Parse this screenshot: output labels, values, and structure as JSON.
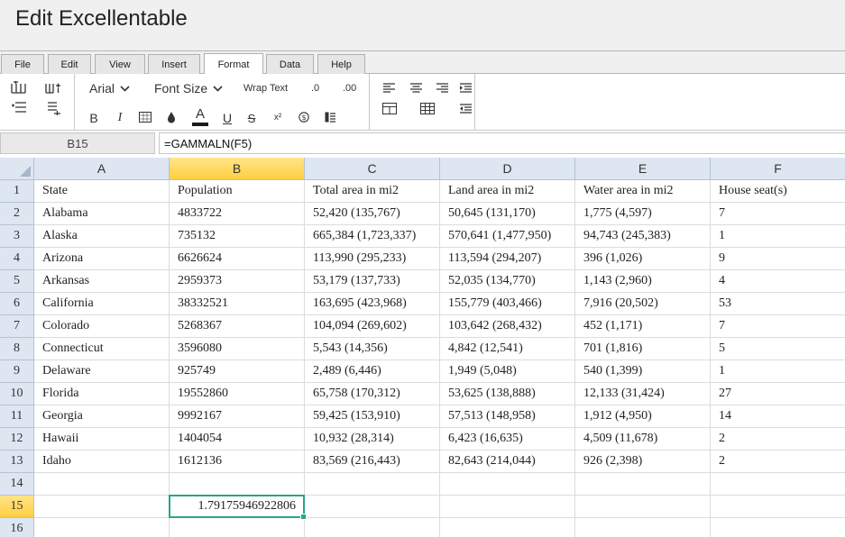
{
  "app": {
    "title": "Edit Excellentable"
  },
  "tabs": [
    "File",
    "Edit",
    "View",
    "Insert",
    "Format",
    "Data",
    "Help"
  ],
  "active_tab": "Format",
  "toolbar": {
    "font_name": "Arial",
    "font_size_label": "Font Size",
    "wrap_text": "Wrap Text",
    "decimal_decrease": ".0",
    "decimal_increase": ".00",
    "bold": "B",
    "italic": "I",
    "underline": "U",
    "strike": "S",
    "superscript": "x²",
    "text_color": "A",
    "text_color_hex": "#1a1a1a"
  },
  "formula_bar": {
    "cell_ref": "B15",
    "formula": "=GAMMALN(F5)"
  },
  "sheet": {
    "columns": [
      "A",
      "B",
      "C",
      "D",
      "E",
      "F"
    ],
    "rows": [
      [
        "State",
        "Population",
        "Total area in mi2",
        "Land area in mi2",
        "Water area in mi2",
        "House seat(s)"
      ],
      [
        "Alabama",
        "4833722",
        "52,420 (135,767)",
        "50,645 (131,170)",
        "1,775 (4,597)",
        "7"
      ],
      [
        "Alaska",
        "735132",
        "665,384 (1,723,337)",
        "570,641 (1,477,950)",
        "94,743 (245,383)",
        "1"
      ],
      [
        "Arizona",
        "6626624",
        "113,990 (295,233)",
        "113,594 (294,207)",
        "396 (1,026)",
        "9"
      ],
      [
        "Arkansas",
        "2959373",
        "53,179 (137,733)",
        "52,035 (134,770)",
        "1,143 (2,960)",
        "4"
      ],
      [
        "California",
        "38332521",
        "163,695 (423,968)",
        "155,779 (403,466)",
        "7,916 (20,502)",
        "53"
      ],
      [
        "Colorado",
        "5268367",
        "104,094 (269,602)",
        "103,642 (268,432)",
        "452 (1,171)",
        "7"
      ],
      [
        "Connecticut",
        "3596080",
        "5,543 (14,356)",
        "4,842 (12,541)",
        "701 (1,816)",
        "5"
      ],
      [
        "Delaware",
        "925749",
        "2,489 (6,446)",
        "1,949 (5,048)",
        "540 (1,399)",
        "1"
      ],
      [
        "Florida",
        "19552860",
        "65,758 (170,312)",
        "53,625 (138,888)",
        "12,133 (31,424)",
        "27"
      ],
      [
        "Georgia",
        "9992167",
        "59,425 (153,910)",
        "57,513 (148,958)",
        "1,912 (4,950)",
        "14"
      ],
      [
        "Hawaii",
        "1404054",
        "10,932 (28,314)",
        "6,423 (16,635)",
        "4,509 (11,678)",
        "2"
      ],
      [
        "Idaho",
        "1612136",
        "83,569 (216,443)",
        "82,643 (214,044)",
        "926 (2,398)",
        "2"
      ],
      [
        "",
        "",
        "",
        "",
        "",
        ""
      ],
      [
        "",
        "1.79175946922806",
        "",
        "",
        "",
        ""
      ],
      [
        "",
        "",
        "",
        "",
        "",
        ""
      ]
    ],
    "selected": {
      "row": 15,
      "col": "B"
    },
    "accent_color": "#26a68a",
    "header_bg": "#dde6f1",
    "selected_header_bg": "#ffd966"
  }
}
